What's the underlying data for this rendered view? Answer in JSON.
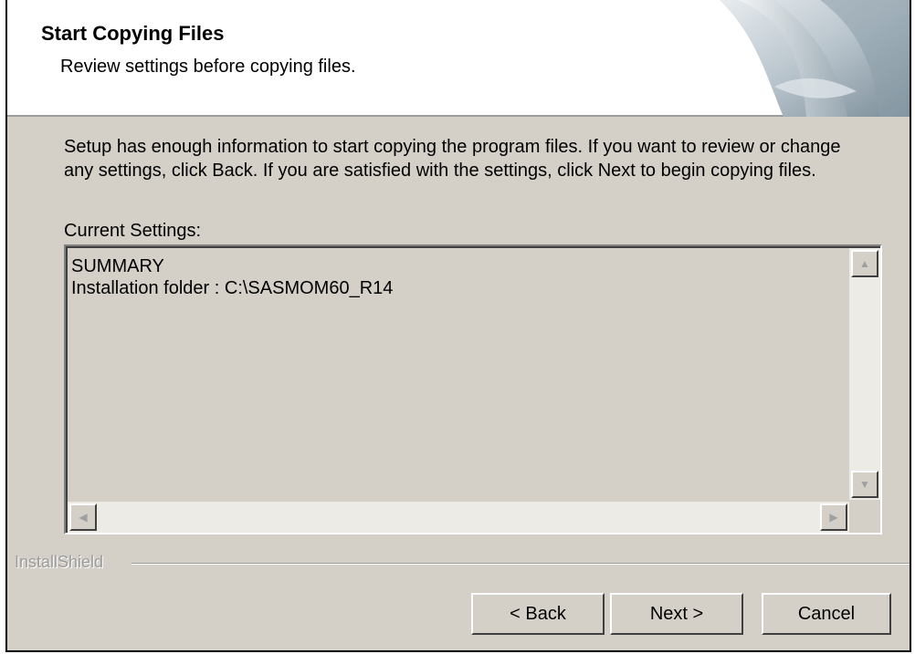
{
  "header": {
    "title": "Start Copying Files",
    "subtitle": "Review settings before copying files."
  },
  "body": {
    "intro": "Setup has enough information to start copying the program files.  If you want to review or change any settings, click Back.  If you are satisfied with the settings, click Next to begin copying files.",
    "settings_label": "Current Settings:",
    "settings_lines": [
      "SUMMARY",
      "Installation folder :  C:\\SASMOM60_R14"
    ]
  },
  "brand": "InstallShield",
  "buttons": {
    "back": "< Back",
    "next": "Next >",
    "cancel": "Cancel"
  },
  "icons": {
    "scroll_up": "scroll-up-arrow-icon",
    "scroll_down": "scroll-down-arrow-icon",
    "scroll_left": "scroll-left-arrow-icon",
    "scroll_right": "scroll-right-arrow-icon",
    "header": "installer-banner-graphic"
  },
  "colors": {
    "dialog_bg": "#d4d0c8",
    "header_bg": "#ffffff",
    "scroll_track": "#ecebe6"
  }
}
